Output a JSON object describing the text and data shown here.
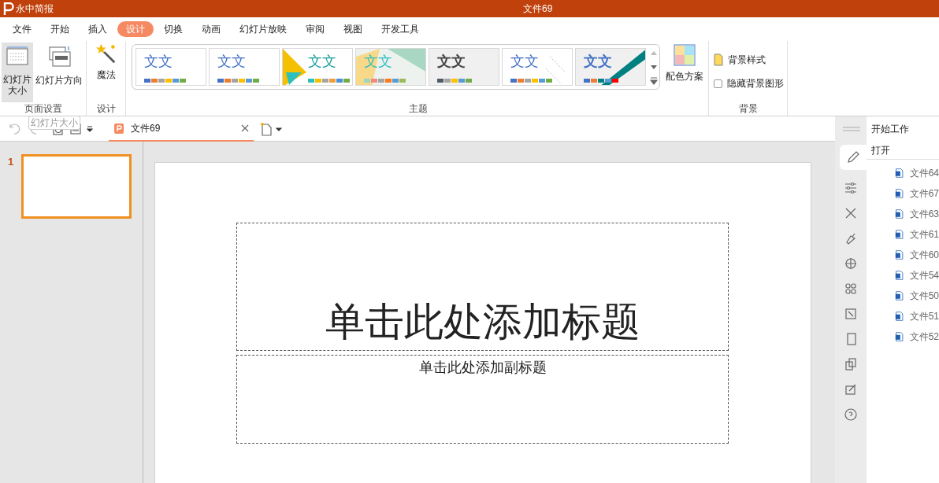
{
  "app": {
    "name": "永中简报",
    "document_title": "文件69"
  },
  "menu": [
    {
      "label": "文件",
      "selected": false
    },
    {
      "label": "开始",
      "selected": false
    },
    {
      "label": "插入",
      "selected": false
    },
    {
      "label": "设计",
      "selected": true
    },
    {
      "label": "切换",
      "selected": false
    },
    {
      "label": "动画",
      "selected": false
    },
    {
      "label": "幻灯片放映",
      "selected": false
    },
    {
      "label": "审阅",
      "selected": false
    },
    {
      "label": "视图",
      "selected": false
    },
    {
      "label": "开发工具",
      "selected": false
    }
  ],
  "ribbon": {
    "page_setup": {
      "slide_size": "幻灯片大小",
      "orientation": "幻灯片方向",
      "group": "页面设置"
    },
    "design": {
      "magic": "魔法",
      "group": "设计"
    },
    "themes": {
      "group": "主题",
      "items": [
        {
          "sample": "文文",
          "kind": "plain",
          "swatches": [
            {
              "color": "#4472c4"
            },
            {
              "color": "#ed7d31"
            },
            {
              "color": "#a5a5a5"
            },
            {
              "color": "#ffc000"
            },
            {
              "color": "#5b9bd5"
            },
            {
              "color": "#70ad47"
            }
          ]
        },
        {
          "sample": "文文",
          "kind": "plain",
          "swatches": [
            {
              "color": "#4472c4"
            },
            {
              "color": "#ed7d31"
            },
            {
              "color": "#a5a5a5"
            },
            {
              "color": "#ffc000"
            },
            {
              "color": "#5b9bd5"
            },
            {
              "color": "#70ad47"
            }
          ]
        },
        {
          "sample": "文文",
          "kind": "triangle",
          "swatches": [
            {
              "color": "#2bbfbf"
            },
            {
              "color": "#f5c000"
            },
            {
              "color": "#a5a5a5"
            },
            {
              "color": "#f39c3c"
            },
            {
              "color": "#4a90d9"
            },
            {
              "color": "#70ad47"
            }
          ]
        },
        {
          "sample": "文文",
          "kind": "pastel",
          "swatches": [
            {
              "color": "#9fd4bf"
            },
            {
              "color": "#f08a7e"
            },
            {
              "color": "#a5a5a5"
            },
            {
              "color": "#f97a1f"
            },
            {
              "color": "#5b9bd5"
            },
            {
              "color": "#9bbb59"
            }
          ]
        },
        {
          "sample": "文文",
          "kind": "grey",
          "swatches": [
            {
              "color": "#505a64"
            },
            {
              "color": "#a5a5a5"
            },
            {
              "color": "#ffc000"
            },
            {
              "color": "#5b9bd5"
            },
            {
              "color": "#70ad47"
            }
          ]
        },
        {
          "sample": "文文",
          "kind": "lines",
          "swatches": [
            {
              "color": "#4472c4"
            },
            {
              "color": "#ed7d31"
            },
            {
              "color": "#a5a5a5"
            },
            {
              "color": "#ffc000"
            },
            {
              "color": "#5b9bd5"
            },
            {
              "color": "#70ad47"
            }
          ]
        },
        {
          "sample": "文文",
          "kind": "teal",
          "swatches": [
            {
              "color": "#4472c4"
            },
            {
              "color": "#ed7d31"
            },
            {
              "color": "#008080"
            },
            {
              "color": "#5b9bd5"
            },
            {
              "color": "#ff0000"
            }
          ]
        }
      ]
    },
    "color_scheme": "配色方案",
    "background": {
      "style": "背景样式",
      "hide_graphics": {
        "label": "隐藏背景图形",
        "checked": false
      },
      "group": "背景"
    }
  },
  "tooltip": "幻灯片大小",
  "document_tab": {
    "label": "文件69"
  },
  "slides": [
    {
      "number": "1",
      "selected": true
    }
  ],
  "slide": {
    "title": "单击此处添加标题",
    "subtitle": "单击此处添加副标题"
  },
  "task_pane": {
    "title": "开始工作",
    "section": "打开",
    "files": [
      "文件64",
      "文件67",
      "文件63",
      "文件61",
      "文件60",
      "文件54",
      "文件50",
      "文件51",
      "文件52"
    ]
  }
}
